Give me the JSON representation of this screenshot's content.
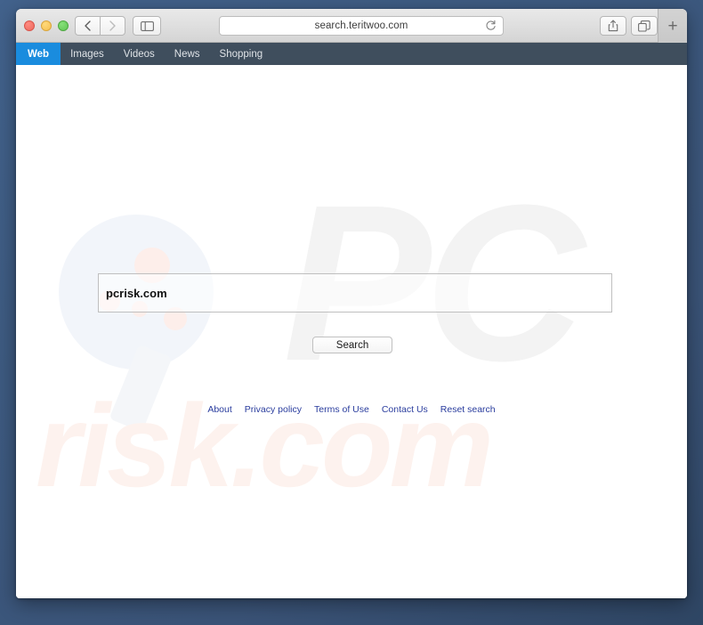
{
  "browser": {
    "address": "search.teritwoo.com",
    "toolbar": {
      "back_label": "‹",
      "forward_label": "›",
      "sidebar_icon": "sidebar-icon",
      "share_icon": "share-icon",
      "tabs_icon": "tabs-icon",
      "reload_icon": "reload-icon",
      "newtab_label": "+"
    },
    "window_controls": {
      "close": "close-button",
      "minimize": "minimize-button",
      "zoom": "zoom-button"
    }
  },
  "navbar": {
    "items": [
      {
        "label": "Web",
        "active": true
      },
      {
        "label": "Images",
        "active": false
      },
      {
        "label": "Videos",
        "active": false
      },
      {
        "label": "News",
        "active": false
      },
      {
        "label": "Shopping",
        "active": false
      }
    ]
  },
  "search": {
    "value": "pcrisk.com",
    "placeholder": "",
    "button_label": "Search"
  },
  "footer": {
    "links": [
      "About",
      "Privacy policy",
      "Terms of Use",
      "Contact Us",
      "Reset search"
    ]
  },
  "watermarks": {
    "top_text": "PC",
    "bottom_text": "risk.com"
  },
  "colors": {
    "desktop_background": "#3d5a80",
    "navbar_background": "#3f4e5d",
    "active_tab": "#1a8cde",
    "link": "#2a3d9e",
    "watermark_gray": "#f3f3f3",
    "watermark_pink": "#fdf2ee"
  }
}
